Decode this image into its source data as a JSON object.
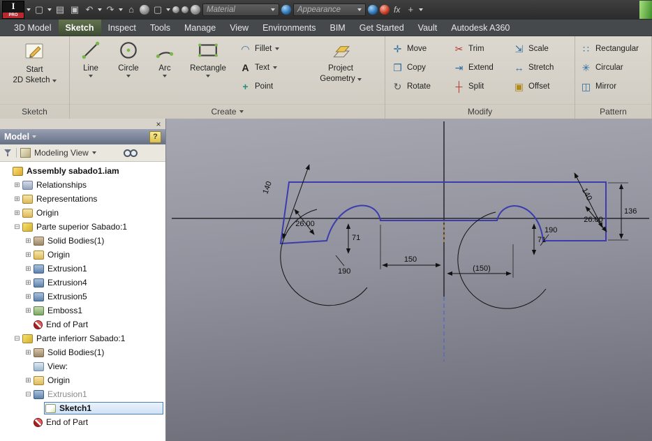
{
  "titlebar": {
    "logo_i": "I",
    "logo_pro": "PRO",
    "material": "Material",
    "appearance": "Appearance",
    "fx": "fx"
  },
  "tabs": [
    "3D Model",
    "Sketch",
    "Inspect",
    "Tools",
    "Manage",
    "View",
    "Environments",
    "BIM",
    "Get Started",
    "Vault",
    "Autodesk A360"
  ],
  "active_tab": "Sketch",
  "ribbon": {
    "sketch_panel": {
      "title": "Sketch",
      "start1": "Start",
      "start2": "2D Sketch"
    },
    "create_panel": {
      "title": "Create",
      "line": "Line",
      "circle": "Circle",
      "arc": "Arc",
      "rectangle": "Rectangle",
      "fillet": "Fillet",
      "text": "Text",
      "point": "Point",
      "project1": "Project",
      "project2": "Geometry"
    },
    "modify_panel": {
      "title": "Modify",
      "move": "Move",
      "copy": "Copy",
      "rotate": "Rotate",
      "trim": "Trim",
      "extend": "Extend",
      "split": "Split",
      "scale": "Scale",
      "stretch": "Stretch",
      "offset": "Offset"
    },
    "pattern_panel": {
      "title": "Pattern",
      "rectangular": "Rectangular",
      "circular": "Circular",
      "mirror": "Mirror"
    }
  },
  "icons": {
    "new": "▢",
    "open": "▤",
    "save": "▣",
    "undo": "↶",
    "redo": "↷",
    "home": "⌂",
    "plus": "+",
    "move": "✛",
    "copy": "❐",
    "rotate": "↻",
    "trim": "✂",
    "extend": "⇥",
    "split": "┼",
    "scale": "⇲",
    "stretch": "↔",
    "offset": "▣",
    "rectangular": "∷",
    "circular": "✳",
    "mirror": "◫",
    "fillet": "◠",
    "text": "A",
    "point": "+"
  },
  "browser": {
    "title": "Model",
    "help": "?",
    "close": "×",
    "view_mode": "Modeling View",
    "tree": [
      {
        "label": "Assembly sabado1.iam",
        "expand": ""
      },
      {
        "label": "Relationships",
        "expand": "⊞"
      },
      {
        "label": "Representations",
        "expand": "⊞"
      },
      {
        "label": "Origin",
        "expand": "⊞"
      },
      {
        "label": "Parte superior Sabado:1",
        "expand": "⊟"
      },
      {
        "label": "Solid Bodies(1)",
        "expand": "⊞"
      },
      {
        "label": "Origin",
        "expand": "⊞"
      },
      {
        "label": "Extrusion1",
        "expand": "⊞"
      },
      {
        "label": "Extrusion4",
        "expand": "⊞"
      },
      {
        "label": "Extrusion5",
        "expand": "⊞"
      },
      {
        "label": "Emboss1",
        "expand": "⊞"
      },
      {
        "label": "End of Part",
        "expand": ""
      },
      {
        "label": "Parte inferiorr Sabado:1",
        "expand": "⊟"
      },
      {
        "label": "Solid Bodies(1)",
        "expand": "⊞"
      },
      {
        "label": "View:",
        "expand": ""
      },
      {
        "label": "Origin",
        "expand": "⊞"
      },
      {
        "label": "Extrusion1",
        "expand": "⊟"
      },
      {
        "label": "Sketch1",
        "expand": ""
      },
      {
        "label": "End of Part",
        "expand": ""
      }
    ]
  },
  "canvas": {
    "dims": {
      "d140L": "140",
      "d26L": "26.00",
      "d71L": "71",
      "d190L": "190",
      "d150": "150",
      "d150ref": "(150)",
      "d190R": "190",
      "d71R": "71",
      "d26R": "26.00",
      "d140R": "140",
      "d136": "136"
    }
  }
}
